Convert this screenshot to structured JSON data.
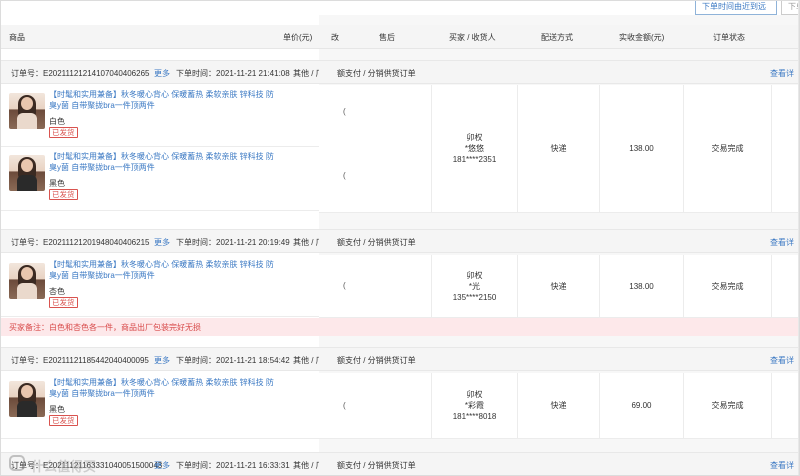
{
  "toolbar": {
    "button1": "下单时间由近到远",
    "button2": "下单"
  },
  "left_header": {
    "product": "商品",
    "unit_price": "单价(元)"
  },
  "right_header": {
    "frag": "改",
    "after_sale": "售后",
    "buyer": "买家 / 收货人",
    "shipping": "配送方式",
    "amount": "实收金额(元)",
    "status": "订单状态"
  },
  "orders": [
    {
      "no": "订单号：E20211121214107040406265",
      "more": "更多",
      "time": "下单时间：2021-11-21 21:41:08",
      "other": "其他 / 厂",
      "right_type": "额支付 / 分销供货订单",
      "view": "查看详",
      "buyer_name": "卯权",
      "receiver": "*悠悠",
      "phone": "181****2351",
      "shipping": "快递",
      "amount": "138.00",
      "status": "交易完成",
      "products": [
        {
          "title": "【时髦和实用兼备】秋冬暖心背心 保暖蓄热 柔软亲肤 锌科技 防臭y菌 自带聚拢bra一件顶两件",
          "color": "白色",
          "badge": "已发货"
        },
        {
          "title": "【时髦和实用兼备】秋冬暖心背心 保暖蓄热 柔软亲肤 锌科技 防臭y菌 自带聚拢bra一件顶两件",
          "color": "黑色",
          "badge": "已发货"
        }
      ]
    },
    {
      "no": "订单号：E20211121201948040406215",
      "more": "更多",
      "time": "下单时间：2021-11-21 20:19:49",
      "other": "其他 / 厂",
      "right_type": "额支付 / 分销供货订单",
      "view": "查看详",
      "buyer_name": "卯权",
      "receiver": "*光",
      "phone": "135****2150",
      "shipping": "快递",
      "amount": "138.00",
      "status": "交易完成",
      "products": [
        {
          "title": "【时髦和实用兼备】秋冬暖心背心 保暖蓄热 柔软亲肤 锌科技 防臭y菌 自带聚拢bra一件顶两件",
          "color": "杏色",
          "badge": "已发货"
        }
      ],
      "note": "买家备注：白色和杏色各一件，商品出厂包装完好无损"
    },
    {
      "no": "订单号：E20211121185442040400095",
      "more": "更多",
      "time": "下单时间：2021-11-21 18:54:42",
      "other": "其他 / 厂",
      "right_type": "额支付 / 分销供货订单",
      "view": "查看详",
      "buyer_name": "卯权",
      "receiver": "*彩霞",
      "phone": "181****8018",
      "shipping": "快递",
      "amount": "69.00",
      "status": "交易完成",
      "products": [
        {
          "title": "【时髦和实用兼备】秋冬暖心背心 保暖蓄热 柔软亲肤 锌科技 防臭y菌 自带聚拢bra一件顶两件",
          "color": "黑色",
          "badge": "已发货"
        }
      ]
    },
    {
      "no": "订单号：E20211121163331040051500043",
      "more": "更多",
      "time": "下单时间：2021-11-21 16:33:31",
      "other": "其他 / 厂",
      "right_type": "额支付 / 分销供货订单",
      "view": "查看详"
    }
  ],
  "side_frag": "(",
  "watermark": "什么值得买"
}
